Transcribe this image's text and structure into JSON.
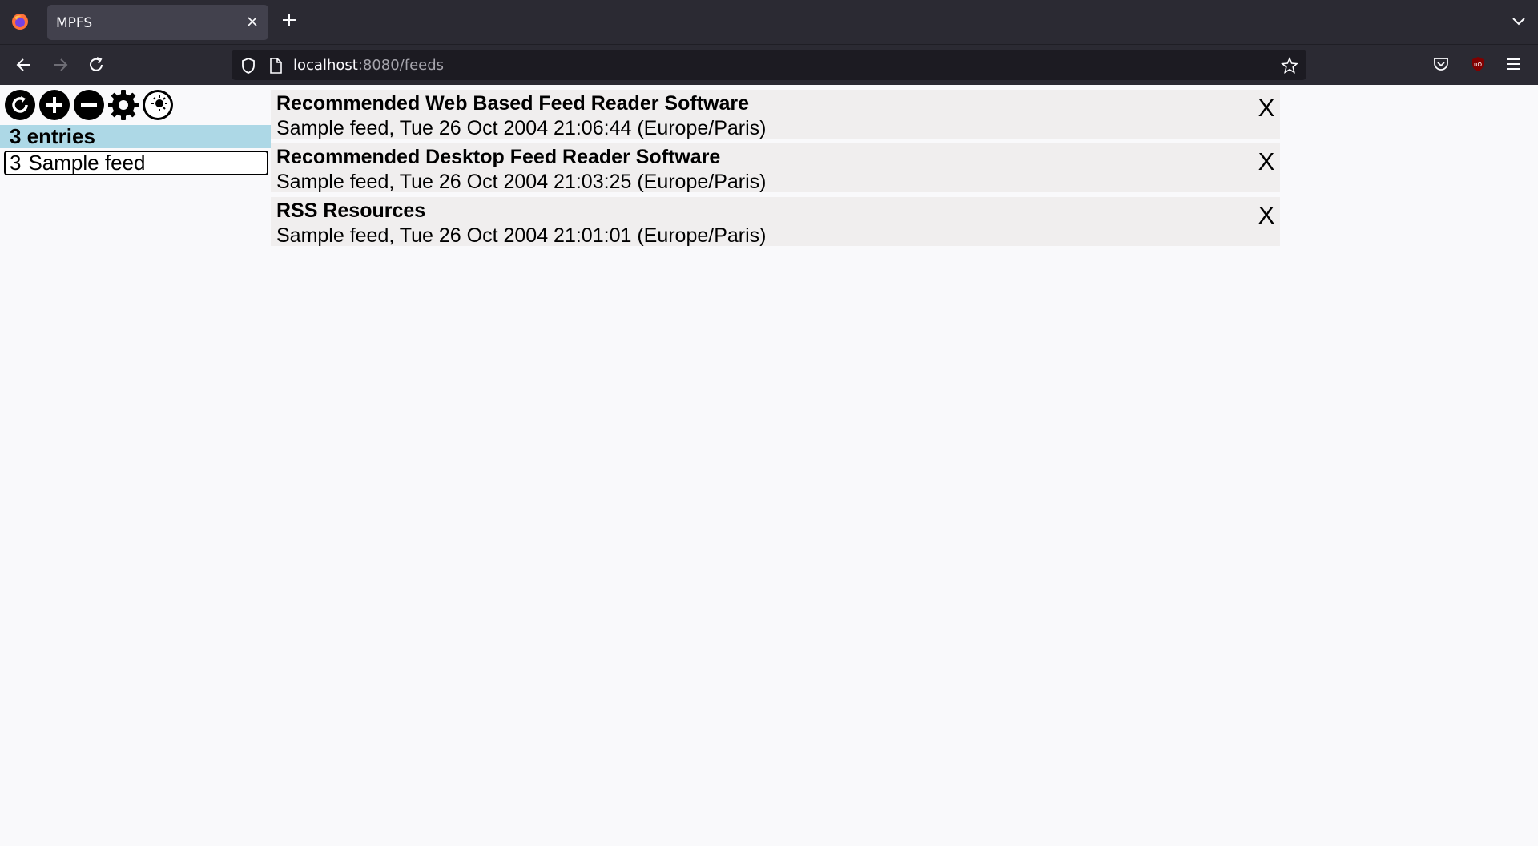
{
  "browser": {
    "tab_title": "MPFS",
    "url_host": "localhost",
    "url_rest": ":8080/feeds",
    "accent": "#2b2a33"
  },
  "sidebar": {
    "toolbar_icons": [
      "refresh-icon",
      "add-icon",
      "remove-icon",
      "settings-icon",
      "theme-icon"
    ],
    "counter": "3 entries",
    "counter_color": "#add8e6",
    "feeds": [
      {
        "count": "3",
        "name": "Sample feed"
      }
    ]
  },
  "entries": [
    {
      "title": "Recommended Web Based Feed Reader Software",
      "meta": "Sample feed, Tue 26 Oct 2004 21:06:44 (Europe/Paris)",
      "close": "X"
    },
    {
      "title": "Recommended Desktop Feed Reader Software",
      "meta": "Sample feed, Tue 26 Oct 2004 21:03:25 (Europe/Paris)",
      "close": "X"
    },
    {
      "title": "RSS Resources",
      "meta": "Sample feed, Tue 26 Oct 2004 21:01:01 (Europe/Paris)",
      "close": "X"
    }
  ]
}
